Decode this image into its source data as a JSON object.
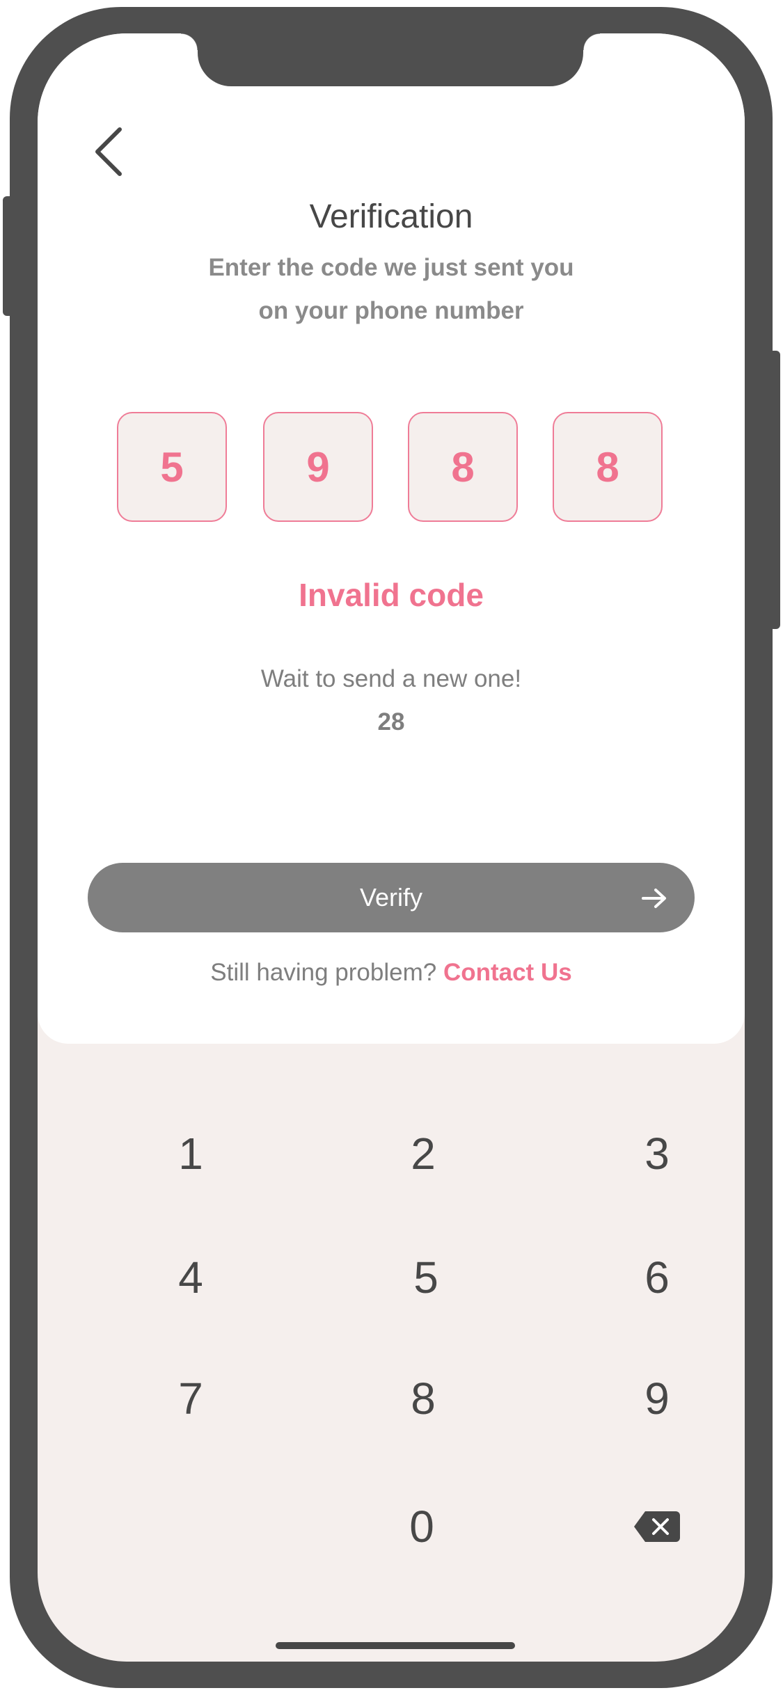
{
  "header": {
    "back_icon": "chevron-left-icon",
    "title": "Verification",
    "subtitle_line1": "Enter the code we just sent you",
    "subtitle_line2": "on your phone number"
  },
  "code": {
    "digits": [
      "5",
      "9",
      "8",
      "8"
    ],
    "error": "Invalid code"
  },
  "resend": {
    "wait_text": "Wait to send a new one!",
    "countdown": "28"
  },
  "verify_button": {
    "label": "Verify",
    "icon": "arrow-right-icon"
  },
  "help": {
    "prompt": "Still having problem?",
    "link": "Contact Us"
  },
  "keypad": {
    "keys": [
      "1",
      "2",
      "3",
      "4",
      "5",
      "6",
      "7",
      "8",
      "9",
      "0"
    ],
    "backspace_icon": "backspace-icon"
  },
  "colors": {
    "accent": "#f0738f",
    "frame": "#4f4f4f",
    "button": "#808080",
    "keypad_bg": "#f5efed"
  }
}
